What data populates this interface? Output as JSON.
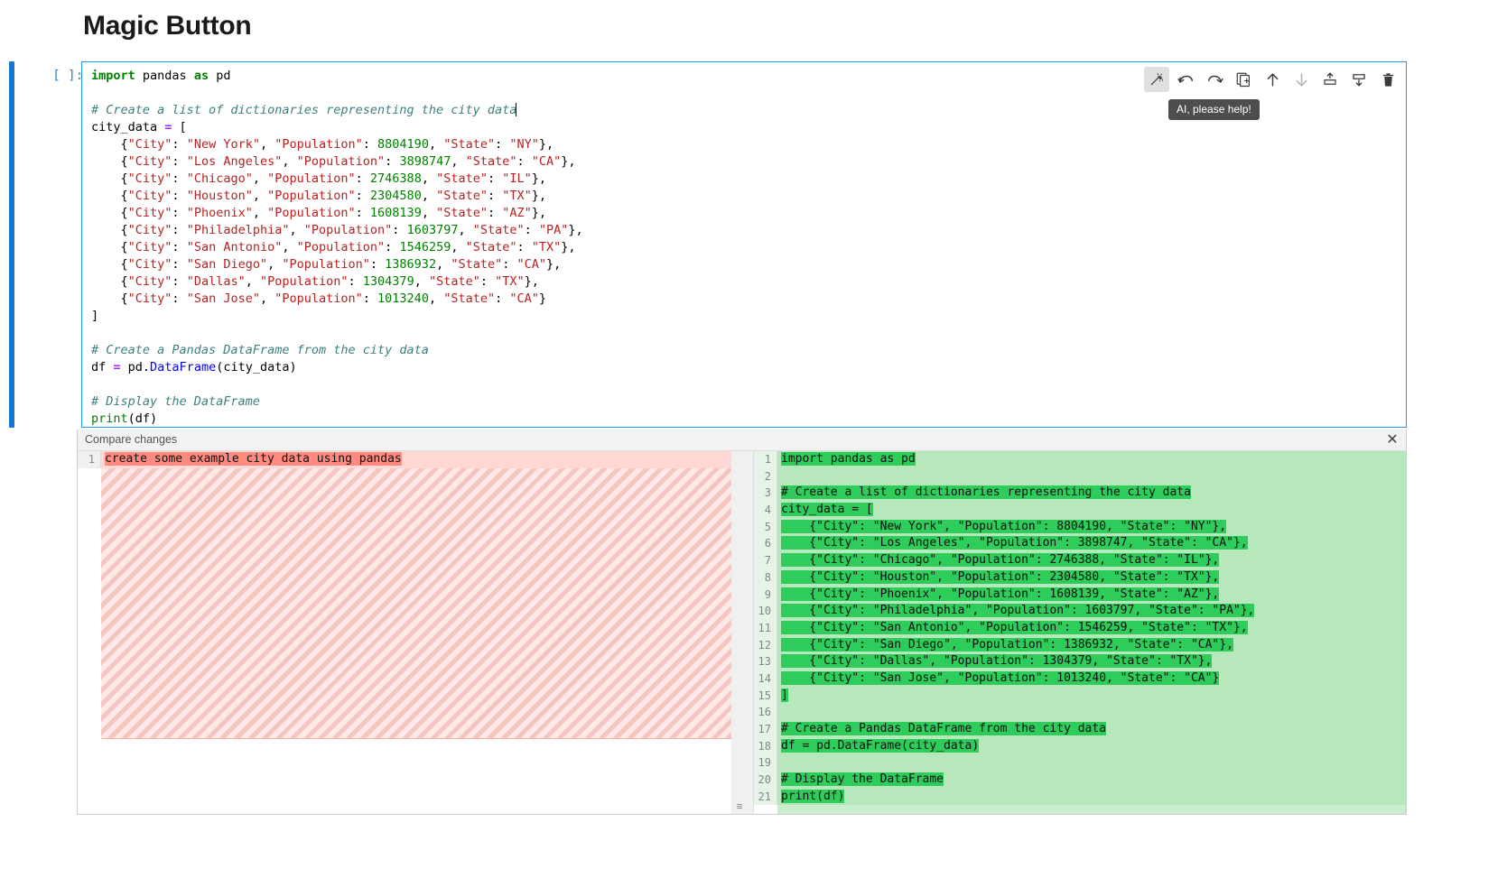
{
  "page": {
    "title": "Magic Button"
  },
  "cell": {
    "prompt": "[ ]:",
    "code_lines": [
      {
        "segs": [
          {
            "t": "import",
            "c": "kw"
          },
          {
            "t": " pandas ",
            "c": ""
          },
          {
            "t": "as",
            "c": "kw"
          },
          {
            "t": " pd",
            "c": ""
          }
        ]
      },
      {
        "segs": []
      },
      {
        "segs": [
          {
            "t": "# Create a list of dictionaries representing the city data",
            "c": "com"
          },
          {
            "t": "│",
            "c": "caret"
          }
        ]
      },
      {
        "segs": [
          {
            "t": "city_data ",
            "c": ""
          },
          {
            "t": "=",
            "c": "op"
          },
          {
            "t": " [",
            "c": ""
          }
        ]
      },
      {
        "segs": [
          {
            "t": "    {",
            "c": ""
          },
          {
            "t": "\"City\"",
            "c": "str"
          },
          {
            "t": ": ",
            "c": ""
          },
          {
            "t": "\"New York\"",
            "c": "str"
          },
          {
            "t": ", ",
            "c": ""
          },
          {
            "t": "\"Population\"",
            "c": "str"
          },
          {
            "t": ": ",
            "c": ""
          },
          {
            "t": "8804190",
            "c": "num"
          },
          {
            "t": ", ",
            "c": ""
          },
          {
            "t": "\"State\"",
            "c": "str"
          },
          {
            "t": ": ",
            "c": ""
          },
          {
            "t": "\"NY\"",
            "c": "str"
          },
          {
            "t": "},",
            "c": ""
          }
        ]
      },
      {
        "segs": [
          {
            "t": "    {",
            "c": ""
          },
          {
            "t": "\"City\"",
            "c": "str"
          },
          {
            "t": ": ",
            "c": ""
          },
          {
            "t": "\"Los Angeles\"",
            "c": "str"
          },
          {
            "t": ", ",
            "c": ""
          },
          {
            "t": "\"Population\"",
            "c": "str"
          },
          {
            "t": ": ",
            "c": ""
          },
          {
            "t": "3898747",
            "c": "num"
          },
          {
            "t": ", ",
            "c": ""
          },
          {
            "t": "\"State\"",
            "c": "str"
          },
          {
            "t": ": ",
            "c": ""
          },
          {
            "t": "\"CA\"",
            "c": "str"
          },
          {
            "t": "},",
            "c": ""
          }
        ]
      },
      {
        "segs": [
          {
            "t": "    {",
            "c": ""
          },
          {
            "t": "\"City\"",
            "c": "str"
          },
          {
            "t": ": ",
            "c": ""
          },
          {
            "t": "\"Chicago\"",
            "c": "str"
          },
          {
            "t": ", ",
            "c": ""
          },
          {
            "t": "\"Population\"",
            "c": "str"
          },
          {
            "t": ": ",
            "c": ""
          },
          {
            "t": "2746388",
            "c": "num"
          },
          {
            "t": ", ",
            "c": ""
          },
          {
            "t": "\"State\"",
            "c": "str"
          },
          {
            "t": ": ",
            "c": ""
          },
          {
            "t": "\"IL\"",
            "c": "str"
          },
          {
            "t": "},",
            "c": ""
          }
        ]
      },
      {
        "segs": [
          {
            "t": "    {",
            "c": ""
          },
          {
            "t": "\"City\"",
            "c": "str"
          },
          {
            "t": ": ",
            "c": ""
          },
          {
            "t": "\"Houston\"",
            "c": "str"
          },
          {
            "t": ", ",
            "c": ""
          },
          {
            "t": "\"Population\"",
            "c": "str"
          },
          {
            "t": ": ",
            "c": ""
          },
          {
            "t": "2304580",
            "c": "num"
          },
          {
            "t": ", ",
            "c": ""
          },
          {
            "t": "\"State\"",
            "c": "str"
          },
          {
            "t": ": ",
            "c": ""
          },
          {
            "t": "\"TX\"",
            "c": "str"
          },
          {
            "t": "},",
            "c": ""
          }
        ]
      },
      {
        "segs": [
          {
            "t": "    {",
            "c": ""
          },
          {
            "t": "\"City\"",
            "c": "str"
          },
          {
            "t": ": ",
            "c": ""
          },
          {
            "t": "\"Phoenix\"",
            "c": "str"
          },
          {
            "t": ", ",
            "c": ""
          },
          {
            "t": "\"Population\"",
            "c": "str"
          },
          {
            "t": ": ",
            "c": ""
          },
          {
            "t": "1608139",
            "c": "num"
          },
          {
            "t": ", ",
            "c": ""
          },
          {
            "t": "\"State\"",
            "c": "str"
          },
          {
            "t": ": ",
            "c": ""
          },
          {
            "t": "\"AZ\"",
            "c": "str"
          },
          {
            "t": "},",
            "c": ""
          }
        ]
      },
      {
        "segs": [
          {
            "t": "    {",
            "c": ""
          },
          {
            "t": "\"City\"",
            "c": "str"
          },
          {
            "t": ": ",
            "c": ""
          },
          {
            "t": "\"Philadelphia\"",
            "c": "str"
          },
          {
            "t": ", ",
            "c": ""
          },
          {
            "t": "\"Population\"",
            "c": "str"
          },
          {
            "t": ": ",
            "c": ""
          },
          {
            "t": "1603797",
            "c": "num"
          },
          {
            "t": ", ",
            "c": ""
          },
          {
            "t": "\"State\"",
            "c": "str"
          },
          {
            "t": ": ",
            "c": ""
          },
          {
            "t": "\"PA\"",
            "c": "str"
          },
          {
            "t": "},",
            "c": ""
          }
        ]
      },
      {
        "segs": [
          {
            "t": "    {",
            "c": ""
          },
          {
            "t": "\"City\"",
            "c": "str"
          },
          {
            "t": ": ",
            "c": ""
          },
          {
            "t": "\"San Antonio\"",
            "c": "str"
          },
          {
            "t": ", ",
            "c": ""
          },
          {
            "t": "\"Population\"",
            "c": "str"
          },
          {
            "t": ": ",
            "c": ""
          },
          {
            "t": "1546259",
            "c": "num"
          },
          {
            "t": ", ",
            "c": ""
          },
          {
            "t": "\"State\"",
            "c": "str"
          },
          {
            "t": ": ",
            "c": ""
          },
          {
            "t": "\"TX\"",
            "c": "str"
          },
          {
            "t": "},",
            "c": ""
          }
        ]
      },
      {
        "segs": [
          {
            "t": "    {",
            "c": ""
          },
          {
            "t": "\"City\"",
            "c": "str"
          },
          {
            "t": ": ",
            "c": ""
          },
          {
            "t": "\"San Diego\"",
            "c": "str"
          },
          {
            "t": ", ",
            "c": ""
          },
          {
            "t": "\"Population\"",
            "c": "str"
          },
          {
            "t": ": ",
            "c": ""
          },
          {
            "t": "1386932",
            "c": "num"
          },
          {
            "t": ", ",
            "c": ""
          },
          {
            "t": "\"State\"",
            "c": "str"
          },
          {
            "t": ": ",
            "c": ""
          },
          {
            "t": "\"CA\"",
            "c": "str"
          },
          {
            "t": "},",
            "c": ""
          }
        ]
      },
      {
        "segs": [
          {
            "t": "    {",
            "c": ""
          },
          {
            "t": "\"City\"",
            "c": "str"
          },
          {
            "t": ": ",
            "c": ""
          },
          {
            "t": "\"Dallas\"",
            "c": "str"
          },
          {
            "t": ", ",
            "c": ""
          },
          {
            "t": "\"Population\"",
            "c": "str"
          },
          {
            "t": ": ",
            "c": ""
          },
          {
            "t": "1304379",
            "c": "num"
          },
          {
            "t": ", ",
            "c": ""
          },
          {
            "t": "\"State\"",
            "c": "str"
          },
          {
            "t": ": ",
            "c": ""
          },
          {
            "t": "\"TX\"",
            "c": "str"
          },
          {
            "t": "},",
            "c": ""
          }
        ]
      },
      {
        "segs": [
          {
            "t": "    {",
            "c": ""
          },
          {
            "t": "\"City\"",
            "c": "str"
          },
          {
            "t": ": ",
            "c": ""
          },
          {
            "t": "\"San Jose\"",
            "c": "str"
          },
          {
            "t": ", ",
            "c": ""
          },
          {
            "t": "\"Population\"",
            "c": "str"
          },
          {
            "t": ": ",
            "c": ""
          },
          {
            "t": "1013240",
            "c": "num"
          },
          {
            "t": ", ",
            "c": ""
          },
          {
            "t": "\"State\"",
            "c": "str"
          },
          {
            "t": ": ",
            "c": ""
          },
          {
            "t": "\"CA\"",
            "c": "str"
          },
          {
            "t": "}",
            "c": ""
          }
        ]
      },
      {
        "segs": [
          {
            "t": "]",
            "c": ""
          }
        ]
      },
      {
        "segs": []
      },
      {
        "segs": [
          {
            "t": "# Create a Pandas DataFrame from the city data",
            "c": "com"
          }
        ]
      },
      {
        "segs": [
          {
            "t": "df ",
            "c": ""
          },
          {
            "t": "=",
            "c": "op"
          },
          {
            "t": " pd.",
            "c": ""
          },
          {
            "t": "DataFrame",
            "c": "fn"
          },
          {
            "t": "(city_data)",
            "c": ""
          }
        ]
      },
      {
        "segs": []
      },
      {
        "segs": [
          {
            "t": "# Display the DataFrame",
            "c": "com"
          }
        ]
      },
      {
        "segs": [
          {
            "t": "print",
            "c": "bi"
          },
          {
            "t": "(df)",
            "c": ""
          }
        ]
      }
    ],
    "toolbar": {
      "buttons": [
        {
          "name": "ai-magic-wand-button",
          "label": "AI, please help!",
          "active": true
        },
        {
          "name": "undo-button",
          "label": "Undo",
          "active": false
        },
        {
          "name": "redo-button",
          "label": "Redo",
          "active": false
        },
        {
          "name": "duplicate-cell-button",
          "label": "Duplicate cell",
          "active": false
        },
        {
          "name": "move-cell-up-button",
          "label": "Move cell up",
          "active": false
        },
        {
          "name": "move-cell-down-button",
          "label": "Move cell down",
          "active": false
        },
        {
          "name": "insert-cell-above-button",
          "label": "Insert cell above",
          "active": false
        },
        {
          "name": "insert-cell-below-button",
          "label": "Insert cell below",
          "active": false
        },
        {
          "name": "delete-cell-button",
          "label": "Delete cell",
          "active": false
        }
      ]
    },
    "tooltip": "AI, please help!"
  },
  "diff": {
    "header_label": "Compare changes",
    "close_label": "✕",
    "collapse_handle": "≡",
    "left": {
      "lines": [
        {
          "num": "1",
          "text": "create some example city data using pandas",
          "type": "del"
        }
      ]
    },
    "right": {
      "lines": [
        {
          "num": "1",
          "text": "import pandas as pd",
          "type": "ins"
        },
        {
          "num": "2",
          "text": "",
          "type": "ins"
        },
        {
          "num": "3",
          "text": "# Create a list of dictionaries representing the city data",
          "type": "ins"
        },
        {
          "num": "4",
          "text": "city_data = [",
          "type": "ins"
        },
        {
          "num": "5",
          "text": "    {\"City\": \"New York\", \"Population\": 8804190, \"State\": \"NY\"},",
          "type": "ins"
        },
        {
          "num": "6",
          "text": "    {\"City\": \"Los Angeles\", \"Population\": 3898747, \"State\": \"CA\"},",
          "type": "ins"
        },
        {
          "num": "7",
          "text": "    {\"City\": \"Chicago\", \"Population\": 2746388, \"State\": \"IL\"},",
          "type": "ins"
        },
        {
          "num": "8",
          "text": "    {\"City\": \"Houston\", \"Population\": 2304580, \"State\": \"TX\"},",
          "type": "ins"
        },
        {
          "num": "9",
          "text": "    {\"City\": \"Phoenix\", \"Population\": 1608139, \"State\": \"AZ\"},",
          "type": "ins"
        },
        {
          "num": "10",
          "text": "    {\"City\": \"Philadelphia\", \"Population\": 1603797, \"State\": \"PA\"},",
          "type": "ins"
        },
        {
          "num": "11",
          "text": "    {\"City\": \"San Antonio\", \"Population\": 1546259, \"State\": \"TX\"},",
          "type": "ins"
        },
        {
          "num": "12",
          "text": "    {\"City\": \"San Diego\", \"Population\": 1386932, \"State\": \"CA\"},",
          "type": "ins"
        },
        {
          "num": "13",
          "text": "    {\"City\": \"Dallas\", \"Population\": 1304379, \"State\": \"TX\"},",
          "type": "ins"
        },
        {
          "num": "14",
          "text": "    {\"City\": \"San Jose\", \"Population\": 1013240, \"State\": \"CA\"}",
          "type": "ins"
        },
        {
          "num": "15",
          "text": "]",
          "type": "ins"
        },
        {
          "num": "16",
          "text": "",
          "type": "ins"
        },
        {
          "num": "17",
          "text": "# Create a Pandas DataFrame from the city data",
          "type": "ins"
        },
        {
          "num": "18",
          "text": "df = pd.DataFrame(city_data)",
          "type": "ins"
        },
        {
          "num": "19",
          "text": "",
          "type": "ins"
        },
        {
          "num": "20",
          "text": "# Display the DataFrame",
          "type": "ins"
        },
        {
          "num": "21",
          "text": "print(df)",
          "type": "ins"
        }
      ]
    }
  },
  "colors": {
    "accent": "#1976d2",
    "diff_add_bg": "#c9edcd",
    "diff_add_hl": "#2ecc5b",
    "diff_del_bg": "#ffd7d5",
    "diff_del_hl": "#ff8a80"
  }
}
